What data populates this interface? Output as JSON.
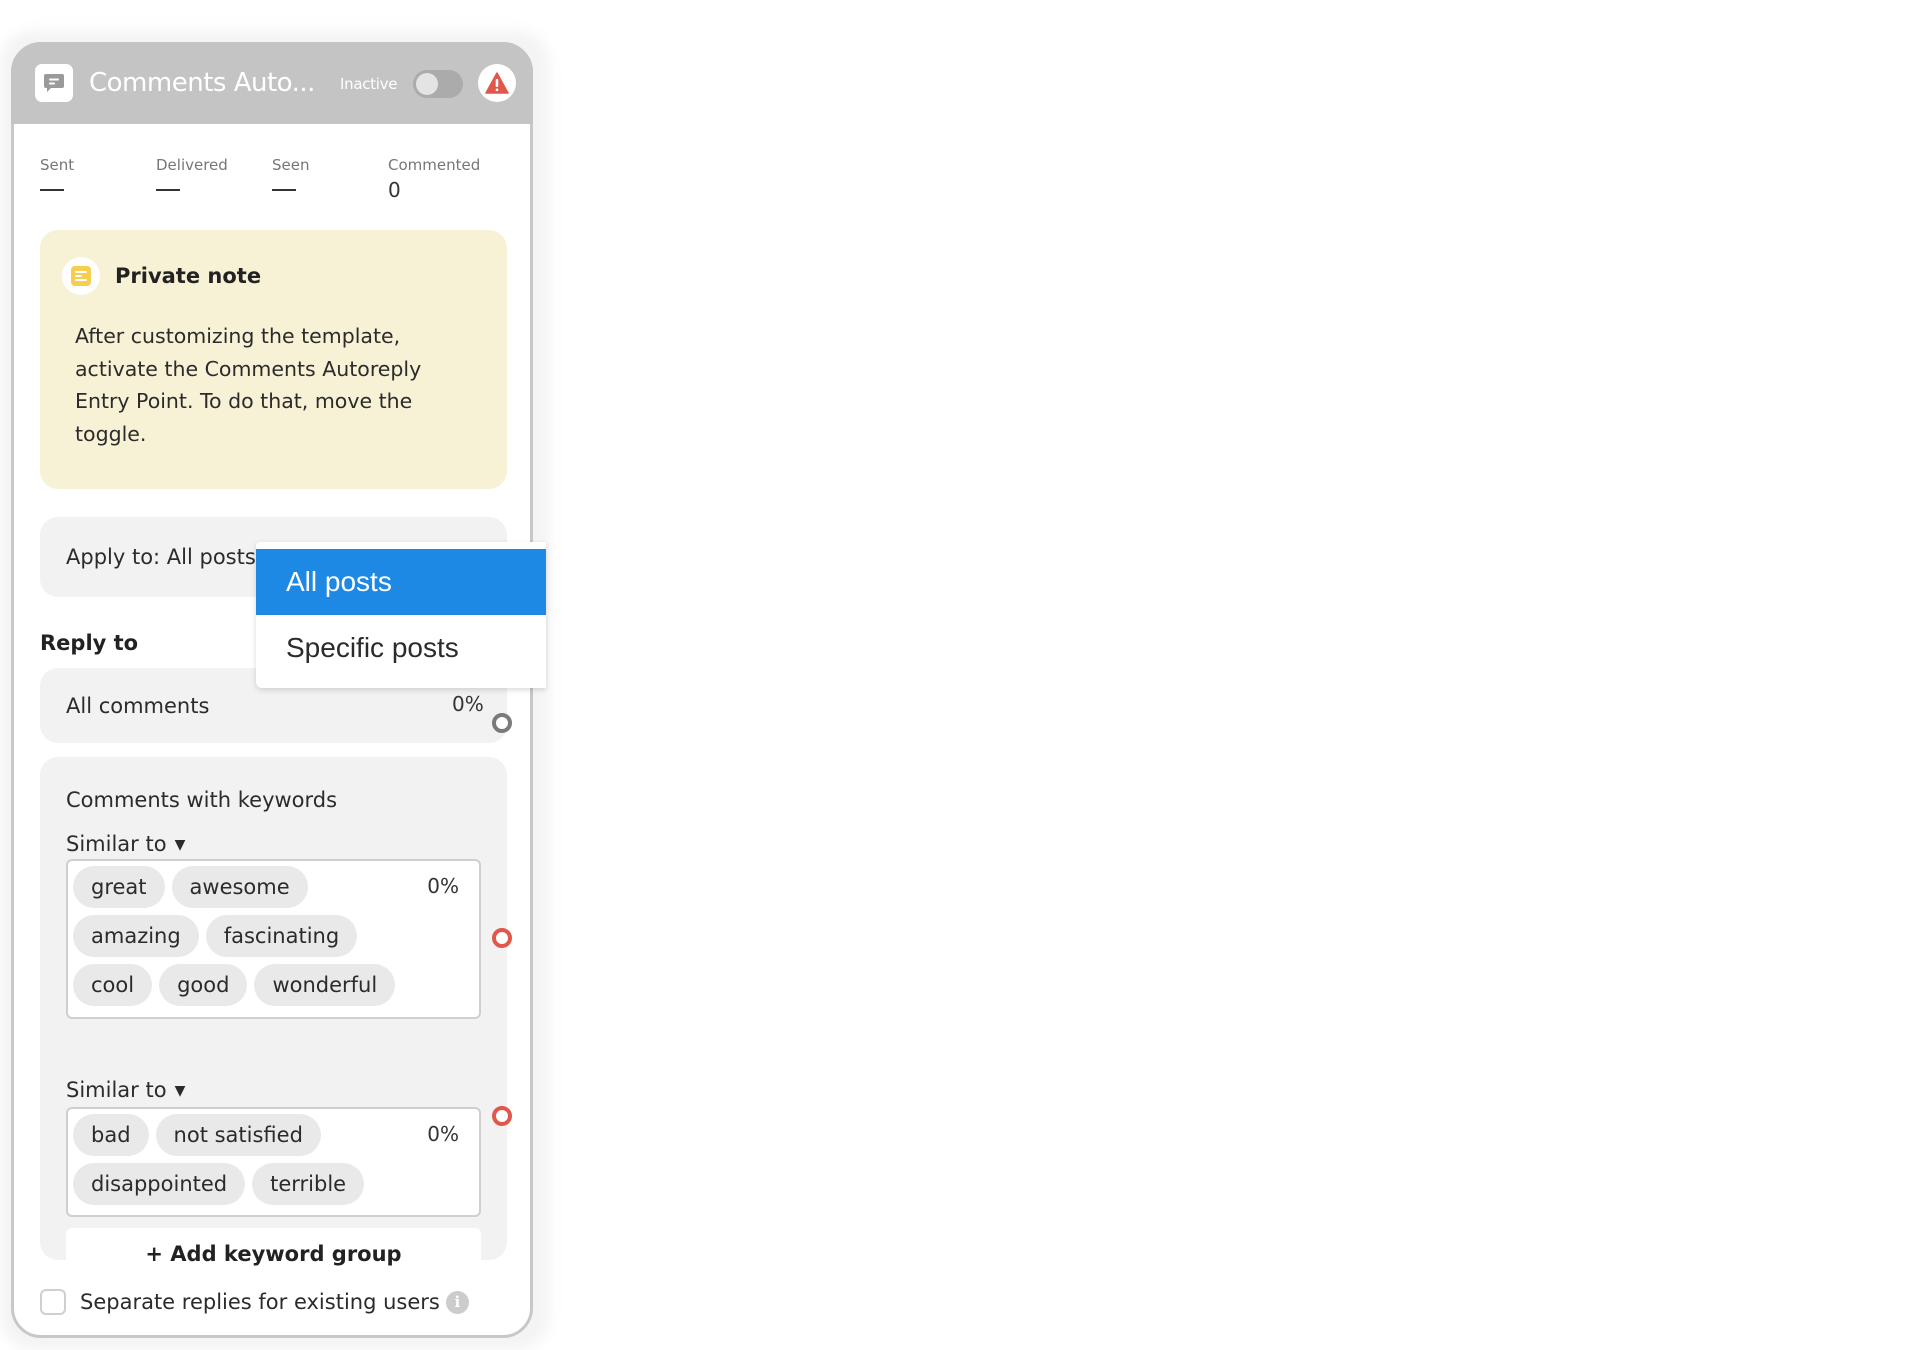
{
  "header": {
    "title": "Comments Auto...",
    "status_label": "Inactive",
    "toggle_on": false,
    "header_icon": "comment-icon",
    "warning_icon": "warning-icon"
  },
  "stats": [
    {
      "label": "Sent",
      "value": "—"
    },
    {
      "label": "Delivered",
      "value": "—"
    },
    {
      "label": "Seen",
      "value": "—"
    },
    {
      "label": "Commented",
      "value": "0"
    }
  ],
  "note": {
    "title": "Private note",
    "body": "After customizing the template, activate the Comments Autoreply Entry Point. To do that, move the toggle."
  },
  "apply_to": {
    "label": "Apply to: All posts",
    "dropdown_options": [
      "All posts",
      "Specific posts"
    ],
    "selected": "All posts"
  },
  "reply_to": {
    "label": "Reply to",
    "all_comments": {
      "label": "All comments",
      "percent": "0%"
    },
    "keywords": {
      "title": "Comments with keywords",
      "groups": [
        {
          "match_label": "Similar to",
          "keywords": [
            "great",
            "awesome",
            "amazing",
            "fascinating",
            "cool",
            "good",
            "wonderful"
          ],
          "percent": "0%"
        },
        {
          "match_label": "Similar to",
          "keywords": [
            "bad",
            "not satisfied",
            "disappointed",
            "terrible"
          ],
          "percent": "0%"
        }
      ],
      "add_group_label": "+  Add keyword group"
    }
  },
  "separate_replies": {
    "label": "Separate replies for existing users",
    "checked": false
  },
  "colors": {
    "header_bg": "#c4c4c4",
    "note_bg": "#f7f2d6",
    "selected_option": "#1e88e5",
    "warning": "#e2574c",
    "note_icon": "#f6cd4c"
  }
}
